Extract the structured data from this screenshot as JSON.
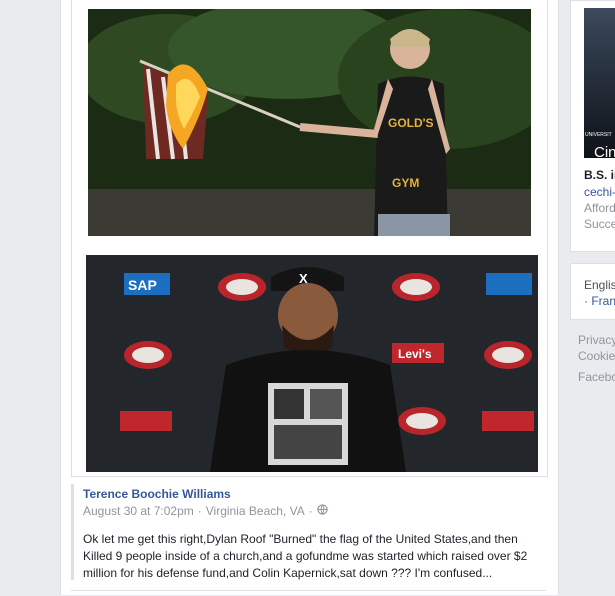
{
  "post": {
    "photo1_text": {
      "shirt_line1": "GOLD'S",
      "shirt_line2": "GYM"
    },
    "photo2_text": {
      "cap_letter": "X",
      "sponsors": [
        "SAP",
        "Levi's"
      ]
    },
    "author": "Terence Boochie Williams",
    "date": "August 30 at 7:02pm",
    "separator": "·",
    "location": "Virginia Beach, VA",
    "privacy_icon": "globe-icon",
    "body": "Ok let me get this right,Dylan Roof \"Burned\" the flag of the United States,and then Killed 9 people inside of a church,and a gofundme was started which raised over $2 million for his defense fund,and Colin Kapernick,sat down ??? I'm confused..."
  },
  "sidebar": {
    "ad": {
      "image_label": "UNIVERSIT",
      "image_word": "Cin",
      "title": "B.S. in",
      "link": "cechi-",
      "lines": [
        "Afford",
        "Succe"
      ]
    },
    "language": {
      "current": "Englis",
      "other": "· Fran"
    },
    "footer": [
      "Privacy",
      "Cookie",
      "Facebo"
    ]
  },
  "colors": {
    "link": "#365899",
    "meta": "#90949c",
    "background": "#e9ebee"
  }
}
